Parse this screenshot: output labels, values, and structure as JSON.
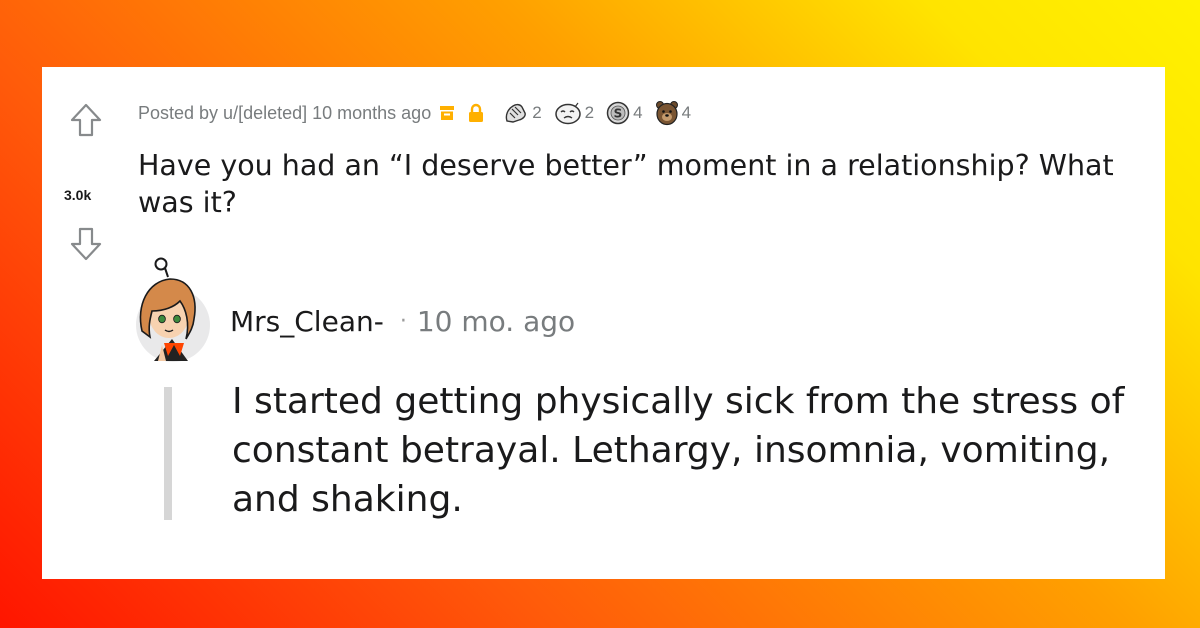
{
  "post": {
    "score": "3.0k",
    "posted_by": "Posted by u/[deleted] 10 months ago",
    "awards": [
      {
        "icon": "hands-award-icon",
        "count": "2"
      },
      {
        "icon": "face-award-icon",
        "count": "2"
      },
      {
        "icon": "silver-award-icon",
        "count": "4"
      },
      {
        "icon": "bear-award-icon",
        "count": "4"
      }
    ],
    "title": "Have you had an “I deserve better” moment in a relationship? What was it?"
  },
  "comment": {
    "author": "Mrs_Clean-",
    "separator": "·",
    "time": "10 mo. ago",
    "text": "I started getting physically sick from the stress of constant betrayal. Lethargy, insomnia, vomiting, and shaking."
  },
  "colors": {
    "archive": "#ffb000",
    "lock": "#ffb000",
    "meta_text": "#787c7e",
    "text": "#1a1a1b"
  }
}
